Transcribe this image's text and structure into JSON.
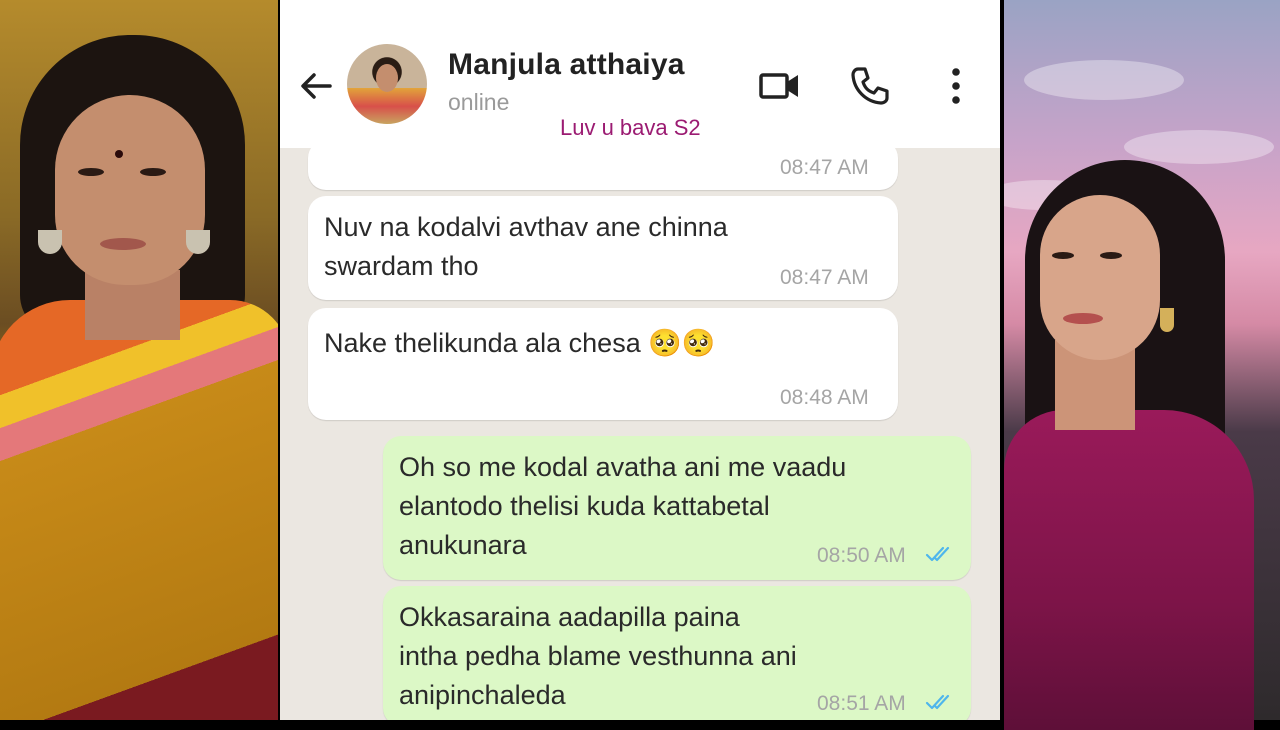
{
  "header": {
    "contact_name": "Manjula atthaiya",
    "status": "online",
    "watermark": "Luv u bava S2",
    "back_icon": "back-arrow-icon",
    "video_icon": "video-call-icon",
    "call_icon": "phone-call-icon",
    "more_icon": "more-options-icon"
  },
  "messages": [
    {
      "direction": "incoming",
      "text": "",
      "time": "08:47 AM"
    },
    {
      "direction": "incoming",
      "text": "Nuv na kodalvi avthav ane chinna\nswardam tho",
      "time": "08:47 AM"
    },
    {
      "direction": "incoming",
      "text": "Nake thelikunda ala chesa 🥺🥺",
      "time": "08:48 AM"
    },
    {
      "direction": "outgoing",
      "text": "Oh so me kodal avatha ani me vaadu\nelantodo thelisi kuda kattabetal\nanukunara",
      "time": "08:50 AM",
      "status": "read"
    },
    {
      "direction": "outgoing",
      "text": "Okkasaraina aadapilla paina\nintha pedha blame vesthunna ani\nanipinchaleda",
      "time": "08:51 AM",
      "status": "read"
    }
  ],
  "colors": {
    "incoming_bubble": "#ffffff",
    "outgoing_bubble": "#dcf8c6",
    "read_ticks": "#4fb6ec",
    "watermark": "#9b1b72"
  }
}
